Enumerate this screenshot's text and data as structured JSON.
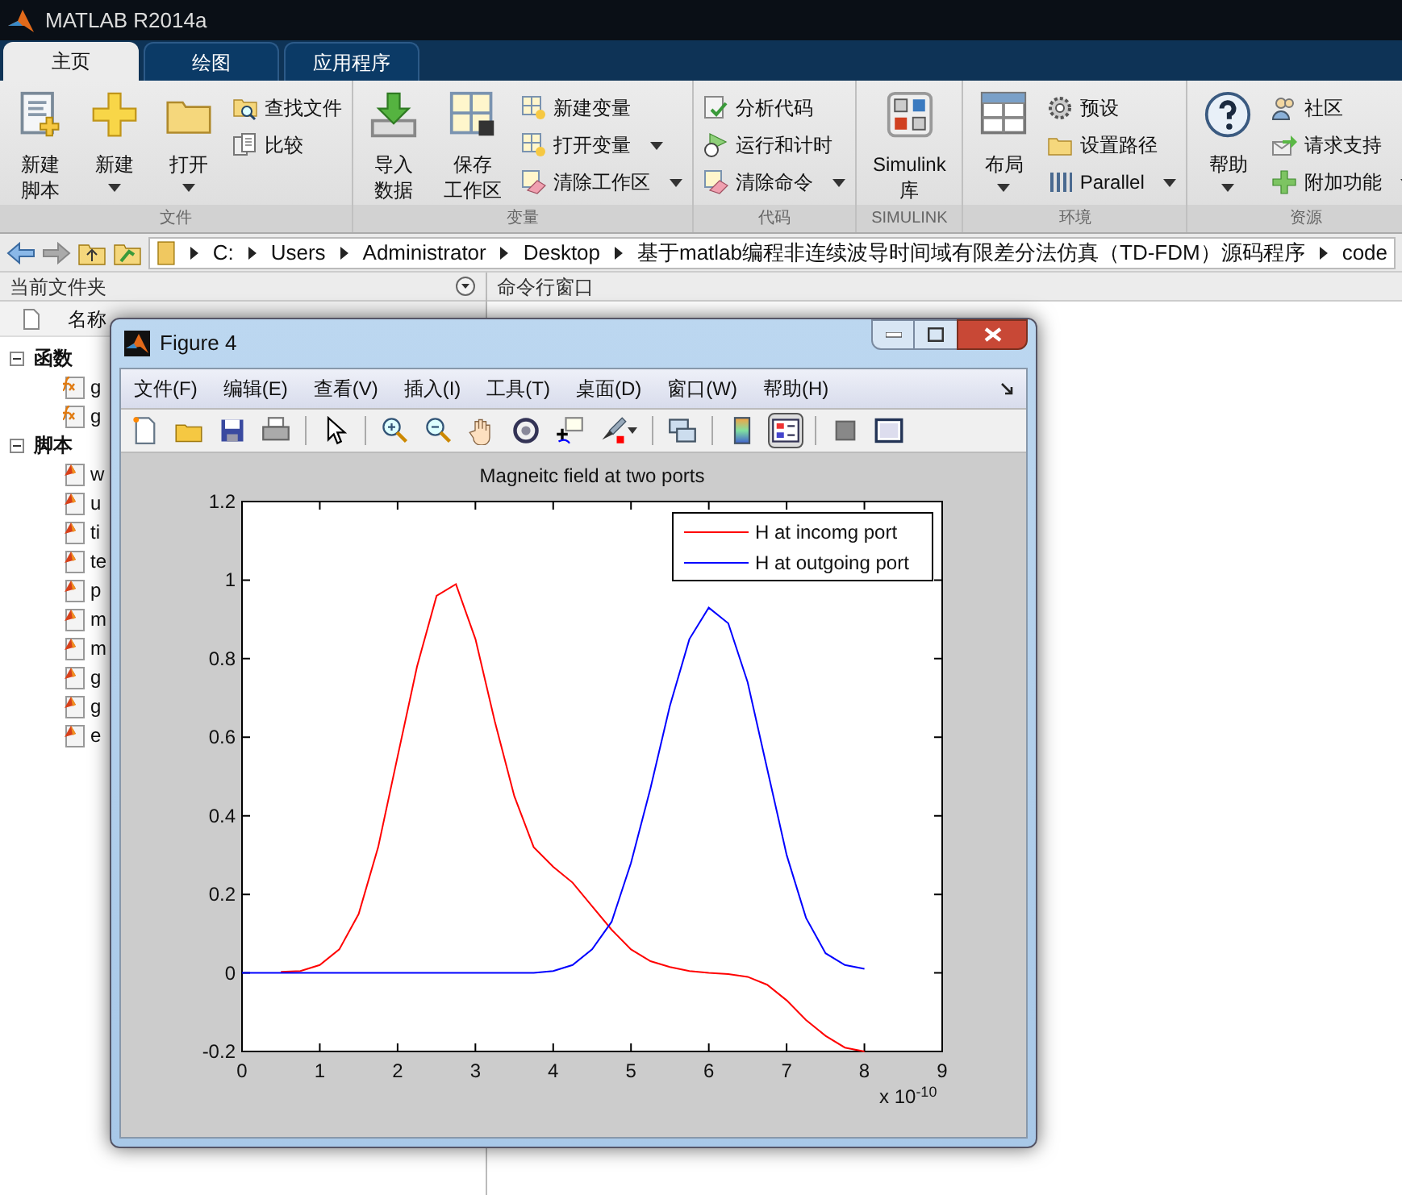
{
  "window": {
    "title": "MATLAB R2014a"
  },
  "tabs": [
    {
      "label": "主页",
      "selected": true
    },
    {
      "label": "绘图",
      "selected": false
    },
    {
      "label": "应用程序",
      "selected": false
    }
  ],
  "ribbon": {
    "sections": [
      {
        "label": "文件",
        "items": [
          {
            "kind": "big",
            "lines": [
              "新建",
              "脚本"
            ],
            "dropdown": false
          },
          {
            "kind": "big",
            "lines": [
              "新建"
            ],
            "dropdown": true
          },
          {
            "kind": "big",
            "lines": [
              "打开"
            ],
            "dropdown": true
          },
          {
            "kind": "stack",
            "entries": [
              {
                "label": "查找文件",
                "dropdown": false
              },
              {
                "label": "比较",
                "dropdown": false
              }
            ]
          }
        ]
      },
      {
        "label": "变量",
        "items": [
          {
            "kind": "big",
            "lines": [
              "导入",
              "数据"
            ],
            "dropdown": false
          },
          {
            "kind": "big",
            "lines": [
              "保存",
              "工作区"
            ],
            "dropdown": false
          },
          {
            "kind": "stack",
            "entries": [
              {
                "label": "新建变量",
                "dropdown": false
              },
              {
                "label": "打开变量",
                "dropdown": true
              },
              {
                "label": "清除工作区",
                "dropdown": true
              }
            ]
          }
        ]
      },
      {
        "label": "代码",
        "items": [
          {
            "kind": "stack",
            "entries": [
              {
                "label": "分析代码",
                "dropdown": false
              },
              {
                "label": "运行和计时",
                "dropdown": false
              },
              {
                "label": "清除命令",
                "dropdown": true
              }
            ]
          }
        ]
      },
      {
        "label": "SIMULINK",
        "items": [
          {
            "kind": "big",
            "lines": [
              "Simulink",
              "库"
            ],
            "dropdown": false
          }
        ]
      },
      {
        "label": "环境",
        "items": [
          {
            "kind": "big",
            "lines": [
              "布局"
            ],
            "dropdown": true
          },
          {
            "kind": "stack",
            "entries": [
              {
                "label": "预设",
                "dropdown": false
              },
              {
                "label": "设置路径",
                "dropdown": false
              },
              {
                "label": "Parallel",
                "dropdown": true
              }
            ]
          }
        ]
      },
      {
        "label": "资源",
        "items": [
          {
            "kind": "big",
            "lines": [
              "帮助"
            ],
            "dropdown": true
          },
          {
            "kind": "stack",
            "entries": [
              {
                "label": "社区",
                "dropdown": false
              },
              {
                "label": "请求支持",
                "dropdown": false
              },
              {
                "label": "附加功能",
                "dropdown": true
              }
            ]
          }
        ]
      }
    ]
  },
  "address_bar": {
    "path": [
      "C:",
      "Users",
      "Administrator",
      "Desktop",
      "基于matlab编程非连续波导时间域有限差分法仿真（TD-FDM）源码程序",
      "code"
    ]
  },
  "current_folder": {
    "title": "当前文件夹",
    "column": "名称",
    "groups": [
      {
        "label": "函数",
        "expanded": true,
        "files": [
          {
            "kind": "function",
            "name": "g"
          },
          {
            "kind": "function",
            "name": "g"
          }
        ]
      },
      {
        "label": "脚本",
        "expanded": true,
        "files": [
          {
            "kind": "script",
            "name": "w"
          },
          {
            "kind": "script",
            "name": "u"
          },
          {
            "kind": "script",
            "name": "ti"
          },
          {
            "kind": "script",
            "name": "te"
          },
          {
            "kind": "script",
            "name": "p"
          },
          {
            "kind": "script",
            "name": "m"
          },
          {
            "kind": "script",
            "name": "m"
          },
          {
            "kind": "script",
            "name": "g"
          },
          {
            "kind": "script",
            "name": "g"
          },
          {
            "kind": "script",
            "name": "e"
          }
        ]
      }
    ]
  },
  "command_window": {
    "title": "命令行窗口"
  },
  "figure": {
    "title": "Figure 4",
    "menu": [
      "文件(F)",
      "编辑(E)",
      "查看(V)",
      "插入(I)",
      "工具(T)",
      "桌面(D)",
      "窗口(W)",
      "帮助(H)"
    ],
    "toolbar": [
      {
        "kind": "button",
        "selected": false
      },
      {
        "kind": "button",
        "selected": false
      },
      {
        "kind": "button",
        "selected": false
      },
      {
        "kind": "button",
        "selected": false
      },
      {
        "kind": "separator"
      },
      {
        "kind": "button",
        "selected": false
      },
      {
        "kind": "separator"
      },
      {
        "kind": "button",
        "selected": false
      },
      {
        "kind": "button",
        "selected": false
      },
      {
        "kind": "button",
        "selected": false
      },
      {
        "kind": "button",
        "selected": false
      },
      {
        "kind": "button",
        "selected": false
      },
      {
        "kind": "button",
        "selected": false
      },
      {
        "kind": "separator"
      },
      {
        "kind": "button",
        "selected": false
      },
      {
        "kind": "separator"
      },
      {
        "kind": "button",
        "selected": false
      },
      {
        "kind": "button",
        "selected": true
      },
      {
        "kind": "separator"
      },
      {
        "kind": "button",
        "selected": false
      },
      {
        "kind": "button",
        "selected": false
      }
    ],
    "x_scale_label": "x 10$^{-10}$",
    "chart_data": {
      "type": "line",
      "title": "Magneitc field at two ports",
      "x": [
        0,
        0.25,
        0.5,
        0.75,
        1,
        1.25,
        1.5,
        1.75,
        2,
        2.25,
        2.5,
        2.75,
        3,
        3.25,
        3.5,
        3.75,
        4,
        4.25,
        4.5,
        4.75,
        5,
        5.25,
        5.5,
        5.75,
        6,
        6.25,
        6.5,
        6.75,
        7,
        7.25,
        7.5,
        7.75,
        8
      ],
      "series": [
        {
          "name": "H at incomg port",
          "color": "#ff0000",
          "values": [
            null,
            null,
            0.003,
            0.005,
            0.02,
            0.06,
            0.15,
            0.32,
            0.55,
            0.78,
            0.96,
            0.99,
            0.85,
            0.64,
            0.45,
            0.32,
            0.27,
            0.23,
            0.17,
            0.11,
            0.06,
            0.03,
            0.015,
            0.005,
            0,
            -0.003,
            -0.01,
            -0.03,
            -0.07,
            -0.12,
            -0.16,
            -0.19,
            -0.2
          ]
        },
        {
          "name": "H at outgoing port",
          "color": "#0000ff",
          "values": [
            0,
            0,
            0,
            0,
            0,
            0,
            0,
            0,
            0,
            0,
            0,
            0,
            0,
            0,
            0,
            0,
            0.005,
            0.02,
            0.06,
            0.13,
            0.28,
            0.47,
            0.68,
            0.85,
            0.93,
            0.89,
            0.74,
            0.52,
            0.3,
            0.14,
            0.05,
            0.02,
            0.01
          ]
        }
      ],
      "xlim": [
        0,
        9
      ],
      "ylim": [
        -0.2,
        1.2
      ],
      "xticks": [
        0,
        1,
        2,
        3,
        4,
        5,
        6,
        7,
        8,
        9
      ],
      "yticks": [
        {
          "value": -0.2,
          "label": "-0.2"
        },
        {
          "value": 0,
          "label": "0"
        },
        {
          "value": 0.2,
          "label": "0.2"
        },
        {
          "value": 0.4,
          "label": "0.4"
        },
        {
          "value": 0.6,
          "label": "0.6"
        },
        {
          "value": 0.8,
          "label": "0.8"
        },
        {
          "value": 1,
          "label": "1"
        },
        {
          "value": 1.2,
          "label": "1.2"
        }
      ],
      "legend": true
    }
  }
}
